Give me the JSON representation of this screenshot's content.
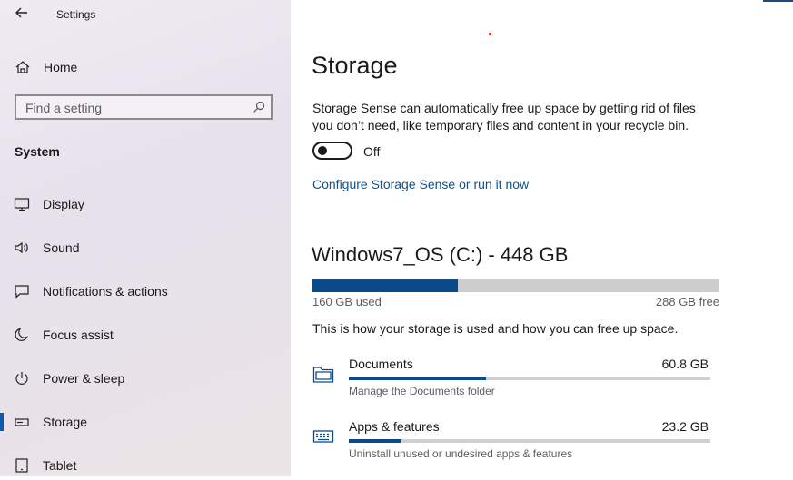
{
  "app": {
    "title": "Settings"
  },
  "sidebar": {
    "home_label": "Home",
    "search_placeholder": "Find a setting",
    "section_title": "System",
    "items": [
      {
        "label": "Display",
        "icon": "monitor-icon"
      },
      {
        "label": "Sound",
        "icon": "speaker-icon"
      },
      {
        "label": "Notifications & actions",
        "icon": "notification-icon"
      },
      {
        "label": "Focus assist",
        "icon": "moon-icon"
      },
      {
        "label": "Power & sleep",
        "icon": "power-icon"
      },
      {
        "label": "Storage",
        "icon": "storage-icon",
        "selected": true
      },
      {
        "label": "Tablet",
        "icon": "tablet-icon"
      }
    ]
  },
  "main": {
    "title": "Storage",
    "description": "Storage Sense can automatically free up space by getting rid of files you don’t need, like temporary files and content in your recycle bin.",
    "toggle_state": "Off",
    "configure_link": "Configure Storage Sense or run it now",
    "drive": {
      "title": "Windows7_OS (C:) - 448 GB",
      "used": "160 GB used",
      "free": "288 GB free",
      "used_fraction": 0.357
    },
    "info_text": "This is how your storage is used and how you can free up space.",
    "categories": [
      {
        "name": "Documents",
        "size": "60.8 GB",
        "sub": "Manage the Documents folder",
        "fraction": 0.38,
        "icon": "folder-icon"
      },
      {
        "name": "Apps & features",
        "size": "23.2 GB",
        "sub": "Uninstall unused or undesired apps & features",
        "fraction": 0.145,
        "icon": "keyboard-icon"
      }
    ]
  },
  "colors": {
    "accent": "#0b4a8a",
    "link": "#0b5394",
    "selection": "#0b5cad"
  }
}
